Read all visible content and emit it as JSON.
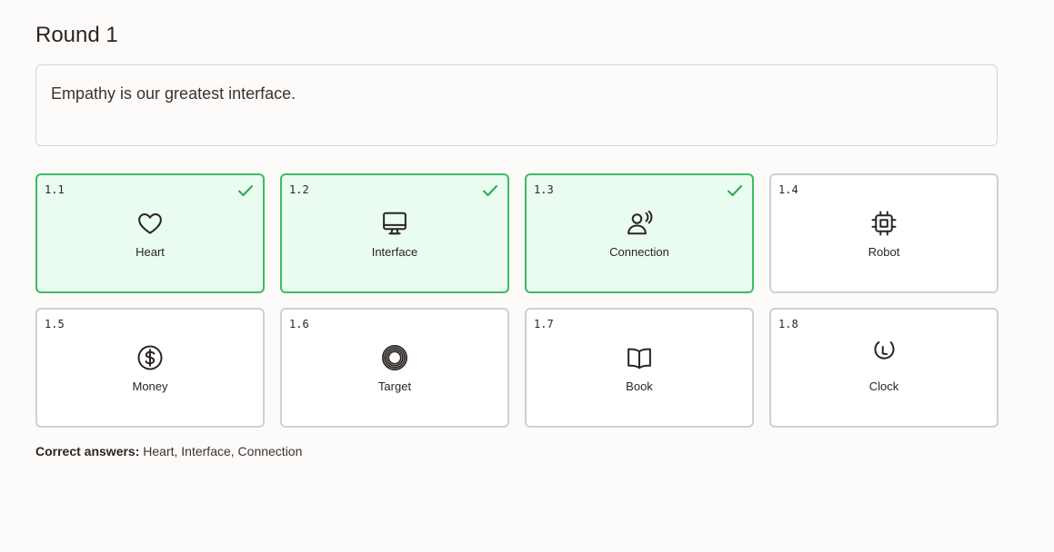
{
  "round": {
    "title": "Round 1"
  },
  "prompt": {
    "text": "Empathy is our greatest interface."
  },
  "colors": {
    "correct_border": "#3dbb63",
    "correct_background": "#eafbf0",
    "check": "#2fa857",
    "default_border": "#d2d0ce"
  },
  "cards": [
    {
      "number": "1.1",
      "label": "Heart",
      "icon": "heart-icon",
      "selected": true
    },
    {
      "number": "1.2",
      "label": "Interface",
      "icon": "monitor-icon",
      "selected": true
    },
    {
      "number": "1.3",
      "label": "Connection",
      "icon": "connection-icon",
      "selected": true
    },
    {
      "number": "1.4",
      "label": "Robot",
      "icon": "chip-icon",
      "selected": false
    },
    {
      "number": "1.5",
      "label": "Money",
      "icon": "dollar-icon",
      "selected": false
    },
    {
      "number": "1.6",
      "label": "Target",
      "icon": "target-icon",
      "selected": false
    },
    {
      "number": "1.7",
      "label": "Book",
      "icon": "book-icon",
      "selected": false
    },
    {
      "number": "1.8",
      "label": "Clock",
      "icon": "clock-icon",
      "selected": false
    }
  ],
  "answers": {
    "label": "Correct answers:",
    "value": "Heart, Interface, Connection"
  }
}
